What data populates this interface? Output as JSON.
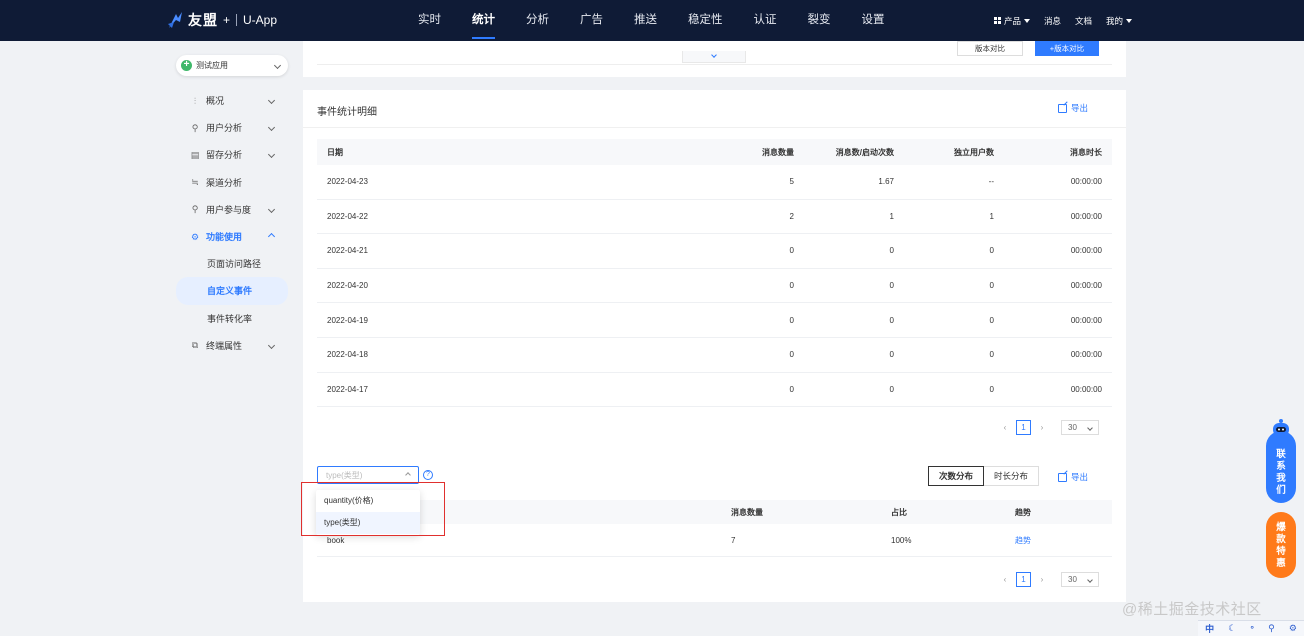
{
  "topbar": {
    "brand_name": "友盟",
    "brand_plus": "+",
    "brand_app": "U-App",
    "nav": [
      "实时",
      "统计",
      "分析",
      "广告",
      "推送",
      "稳定性",
      "认证",
      "裂变",
      "设置"
    ],
    "active_nav": "统计",
    "right": {
      "product": "产品",
      "message": "消息",
      "docs": "文档",
      "mine": "我的"
    }
  },
  "sidebar": {
    "app_name": "测试应用",
    "items": [
      {
        "label": "概况",
        "icon": "chart-icon"
      },
      {
        "label": "用户分析",
        "icon": "user-analysis-icon"
      },
      {
        "label": "留存分析",
        "icon": "retention-icon"
      },
      {
        "label": "渠道分析",
        "icon": "channel-icon"
      },
      {
        "label": "用户参与度",
        "icon": "engagement-icon"
      },
      {
        "label": "功能使用",
        "icon": "gear-icon"
      },
      {
        "label": "页面访问路径"
      },
      {
        "label": "自定义事件"
      },
      {
        "label": "事件转化率"
      },
      {
        "label": "终端属性",
        "icon": "device-icon"
      }
    ]
  },
  "toolbar": {
    "version_select": "版本对比",
    "version_button": "+版本对比"
  },
  "detail": {
    "title": "事件统计明细",
    "export": "导出",
    "columns": [
      "日期",
      "消息数量",
      "消息数/启动次数",
      "独立用户数",
      "消息时长"
    ],
    "rows": [
      [
        "2022-04-23",
        "5",
        "1.67",
        "--",
        "00:00:00"
      ],
      [
        "2022-04-22",
        "2",
        "1",
        "1",
        "00:00:00"
      ],
      [
        "2022-04-21",
        "0",
        "0",
        "0",
        "00:00:00"
      ],
      [
        "2022-04-20",
        "0",
        "0",
        "0",
        "00:00:00"
      ],
      [
        "2022-04-19",
        "0",
        "0",
        "0",
        "00:00:00"
      ],
      [
        "2022-04-18",
        "0",
        "0",
        "0",
        "00:00:00"
      ],
      [
        "2022-04-17",
        "0",
        "0",
        "0",
        "00:00:00"
      ]
    ],
    "pager": {
      "page": "1",
      "page_size": "30"
    }
  },
  "distribution": {
    "select_placeholder": "type(类型)",
    "help": "?",
    "tab_count": "次数分布",
    "tab_duration": "时长分布",
    "export": "导出",
    "dropdown_options": [
      "quantity(价格)",
      "type(类型)"
    ],
    "columns": [
      "",
      "消息数量",
      "占比",
      "趋势"
    ],
    "rows": [
      [
        "book",
        "7",
        "100%",
        "趋势"
      ]
    ],
    "pager": {
      "page": "1",
      "page_size": "30"
    }
  },
  "floating": {
    "contact": [
      "联",
      "系",
      "我",
      "们"
    ],
    "deal": [
      "爆",
      "款",
      "特",
      "惠"
    ]
  },
  "watermark": "@稀土掘金技术社区",
  "ime": [
    "中",
    "☾",
    "°",
    "⚲",
    "⚙"
  ],
  "colors": {
    "accent": "#2f7bff",
    "topbar": "#0f1b36",
    "highlight_box": "#e0302e",
    "deal": "#ff7a1a"
  }
}
